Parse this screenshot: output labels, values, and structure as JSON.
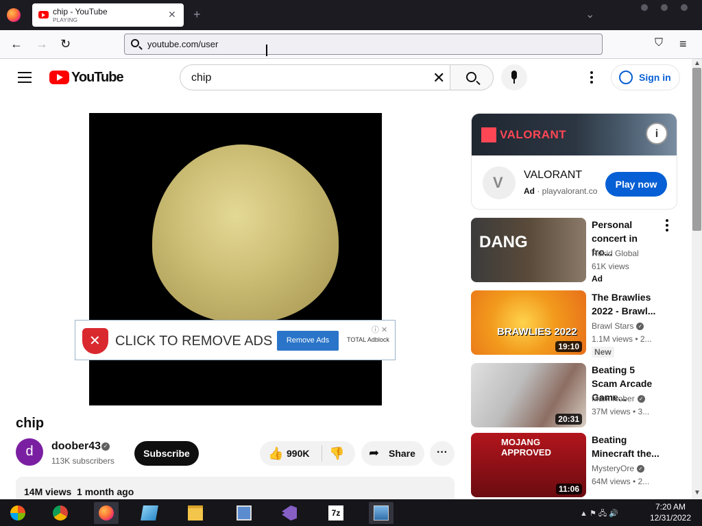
{
  "browser": {
    "tab_title": "chip - YouTube",
    "tab_status": "PLAYING",
    "tab_close": "✕",
    "new_tab": "+",
    "tab_list": "⌄",
    "url": "youtube.com/user",
    "back": "←",
    "forward": "→",
    "reload": "↻",
    "pocket": "⛉",
    "menu": "≡"
  },
  "youtube": {
    "logo_text": "YouTube",
    "search_query": "chip",
    "clear": "✕",
    "sign_in": "Sign in"
  },
  "video": {
    "title": "chip",
    "channel_initial": "d",
    "channel_name": "doober43",
    "subscribers": "113K subscribers",
    "subscribe": "Subscribe",
    "likes": "990K",
    "share": "Share",
    "more": "···",
    "meta": "14M views  1 month ago"
  },
  "adblock_banner": {
    "text": "CLICK TO REMOVE ADS",
    "button": "Remove Ads",
    "brand": "TOTAL Adblock",
    "info": "ⓘ ✕"
  },
  "ad_card": {
    "brand_banner": "VALORANT",
    "name": "VALORANT",
    "ad_label": "Ad",
    "domain": "playvalorant.co",
    "cta": "Play now"
  },
  "recommendations": [
    {
      "title": "Personal concert in fro...",
      "channel": "Rokid Global",
      "views": "61K views",
      "badge": "Ad",
      "duration": "",
      "thumb_text": "DANG",
      "thumb_color": "#2a2a2a"
    },
    {
      "title": "The Brawlies 2022 - Brawl...",
      "channel": "Brawl Stars",
      "views": "1.1M views  • 2...",
      "badge": "New",
      "duration": "19:10",
      "thumb_text": "BRAWLIES 2022",
      "thumb_color": "#f29a1c"
    },
    {
      "title": "Beating 5 Scam Arcade Game...",
      "channel": "Mark Rober",
      "views": "37M views  • 3...",
      "badge": "",
      "duration": "20:31",
      "thumb_text": "",
      "thumb_color": "#c9c9c9"
    },
    {
      "title": "Beating Minecraft the...",
      "channel": "MysteryOre",
      "views": "64M views  • 2...",
      "badge": "",
      "duration": "11:06",
      "thumb_text": "MOJANG APPROVED",
      "thumb_color": "#b3151c"
    }
  ],
  "taskbar": {
    "time": "7:20 AM",
    "date": "12/31/2022",
    "tray": "▲  ⚑  🖧  🔊"
  }
}
